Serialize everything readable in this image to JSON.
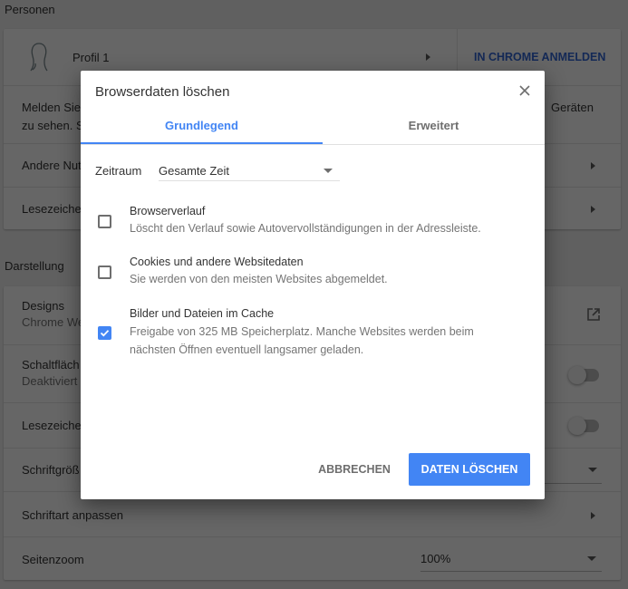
{
  "settings": {
    "people": {
      "section_title": "Personen",
      "profile_name": "Profil 1",
      "signin_button": "IN CHROME ANMELDEN",
      "signin_text_line1": "Melden Sie",
      "signin_text_line1_end": "Geräten",
      "signin_text_line2": "zu sehen. S",
      "other_users": "Andere Nut",
      "bookmarks": "Lesezeiche"
    },
    "appearance": {
      "section_title": "Darstellung",
      "themes_label": "Designs",
      "themes_sub": "Chrome We",
      "home_button_label": "Schaltfläch",
      "home_button_sub": "Deaktiviert",
      "bookmarks_bar_label": "Lesezeiche",
      "font_size_label": "Schriftgröß",
      "customize_fonts_label": "Schriftart anpassen",
      "page_zoom_label": "Seitenzoom",
      "page_zoom_value": "100%"
    }
  },
  "dialog": {
    "title": "Browserdaten löschen",
    "tabs": [
      {
        "label": "Grundlegend",
        "active": true
      },
      {
        "label": "Erweitert",
        "active": false
      }
    ],
    "time_range": {
      "label": "Zeitraum",
      "value": "Gesamte Zeit"
    },
    "options": [
      {
        "title": "Browserverlauf",
        "description": "Löscht den Verlauf sowie Autovervollständigungen in der Adressleiste.",
        "checked": false
      },
      {
        "title": "Cookies und andere Websitedaten",
        "description": "Sie werden von den meisten Websites abgemeldet.",
        "checked": false
      },
      {
        "title": "Bilder und Dateien im Cache",
        "description": "Freigabe von 325 MB Speicherplatz. Manche Websites werden beim nächsten Öffnen eventuell langsamer geladen.",
        "checked": true
      }
    ],
    "cancel_label": "ABBRECHEN",
    "confirm_label": "DATEN LÖSCHEN"
  },
  "colors": {
    "accent": "#4285f4",
    "scrim": "rgba(0,0,0,0.6)"
  }
}
